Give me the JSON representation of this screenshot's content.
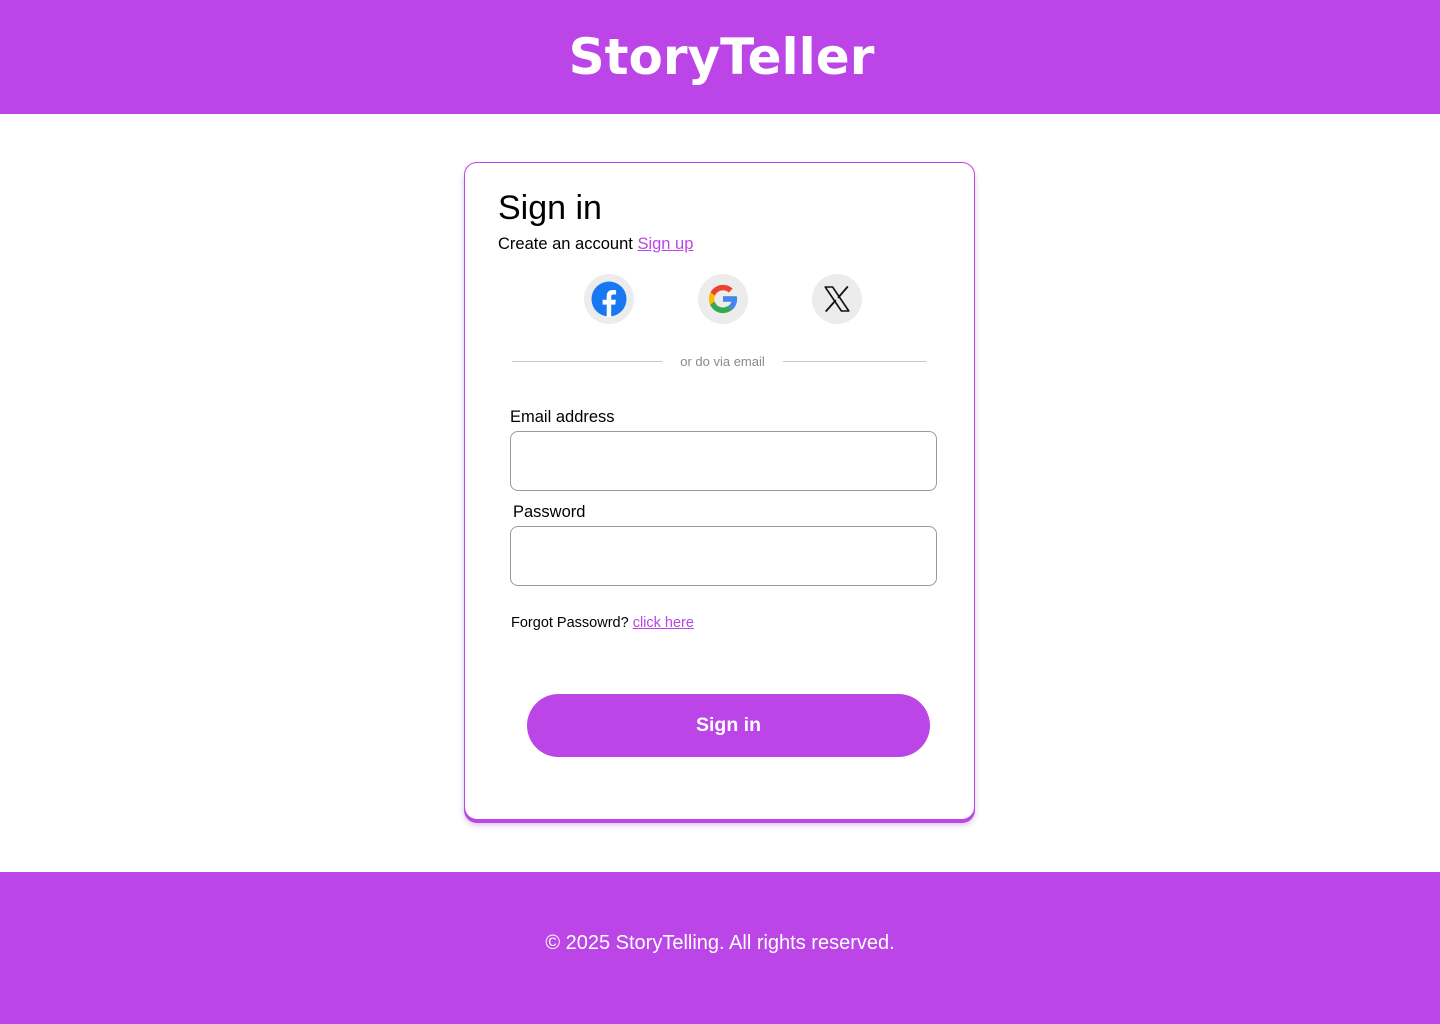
{
  "header": {
    "brand": "StoryTeller"
  },
  "signin": {
    "title": "Sign in",
    "create_account_text": "Create an account",
    "signup_link": "Sign up",
    "social": [
      {
        "name": "facebook",
        "icon": "facebook-icon"
      },
      {
        "name": "google",
        "icon": "google-icon"
      },
      {
        "name": "x",
        "icon": "x-icon"
      }
    ],
    "divider_text": "or do via email",
    "email_label": "Email address",
    "email_value": "",
    "password_label": "Password",
    "password_value": "",
    "forgot_text": "Forgot Passowrd?",
    "forgot_link": "click here",
    "submit_label": "Sign in"
  },
  "footer": {
    "copyright": "© 2025 StoryTelling. All rights reserved."
  },
  "colors": {
    "accent": "#bb45e6",
    "facebook": "#1877f2",
    "google_blue": "#4285f4",
    "google_red": "#ea4335",
    "google_yellow": "#fbbc05",
    "google_green": "#34a853"
  }
}
